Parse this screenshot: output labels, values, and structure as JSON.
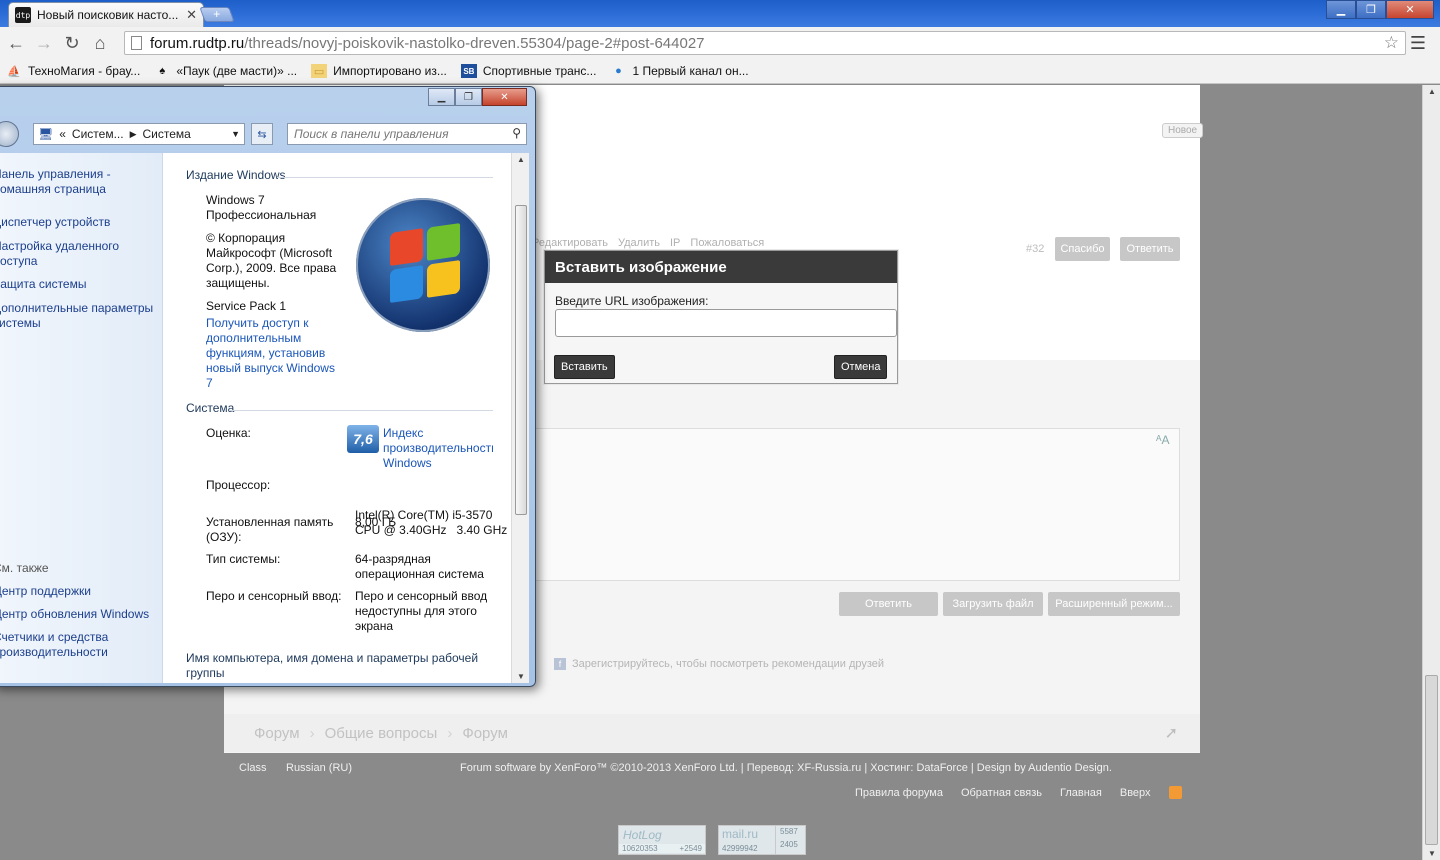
{
  "browser": {
    "tab_title": "Новый поисковик насто...",
    "tab_favicon_text": "dtp",
    "new_tab_symbol": "+",
    "window_buttons": [
      "▁",
      "❐",
      "✕"
    ],
    "nav": {
      "back_icon": "arrow-left-icon",
      "forward_icon": "arrow-right-icon",
      "reload_icon": "reload-icon",
      "home_icon": "home-icon"
    },
    "url_host": "forum.rudtp.ru",
    "url_path": "/threads/novyj-poiskovik-nastolko-dreven.55304/page-2#post-644027",
    "bookmarks": [
      {
        "label": "ТехноМагия - брау...",
        "icon": "⛵"
      },
      {
        "label": "«Паук (две масти)» ...",
        "icon": "♠"
      },
      {
        "label": "Импортировано из...",
        "icon": "▭"
      },
      {
        "label": "Спортивные транс...",
        "icon": "SB"
      },
      {
        "label": "1 Первый канал он...",
        "icon": "●"
      }
    ]
  },
  "forum": {
    "new_badge": "Новое",
    "post_actions": [
      "Редактировать",
      "Удалить",
      "IP",
      "Пожаловаться"
    ],
    "post_number": "#32",
    "thanks_button": "Спасибо",
    "reply_button_top": "Ответить",
    "reply_button": "Ответить",
    "upload_button": "Загрузить файл",
    "advanced_button": "Расширенный режим...",
    "facebook_text": "Зарегистрируйтесь, чтобы посмотреть рекомендации друзей",
    "breadcrumb": [
      "Форум",
      "Общие вопросы",
      "Форум"
    ],
    "footer": {
      "style": "Class",
      "language": "Russian (RU)",
      "credits": "Forum software by XenForo™ ©2010-2013 XenForo Ltd. | Перевод: XF-Russia.ru | Хостинг: DataForce | Design by Audentio Design.",
      "links": [
        "Правила форума",
        "Обратная связь",
        "Главная",
        "Вверх"
      ]
    },
    "counters": {
      "hotlog": {
        "name": "HotLog",
        "n1": "10620353",
        "n2": "+2549"
      },
      "mailru": {
        "name": "mail.ru",
        "n1": "42999942",
        "n2": "5587",
        "n3": "2405"
      }
    }
  },
  "modal": {
    "title": "Вставить изображение",
    "label": "Введите URL изображения:",
    "input_value": "",
    "insert_button": "Вставить",
    "cancel_button": "Отмена"
  },
  "win7": {
    "breadcrumb": [
      "Систем...",
      "Система"
    ],
    "search_placeholder": "Поиск в панели управления",
    "left_links": [
      "Панель управления -",
      "домашняя страница",
      "Диспетчер устройств",
      "Настройка удаленного",
      "доступа",
      "Защита системы",
      "Дополнительные параметры",
      "системы"
    ],
    "see_also": "См. также",
    "see_also_links": [
      "Центр поддержки",
      "Центр обновления Windows",
      "Счетчики и средства",
      "производительности"
    ],
    "edition_section": "Издание Windows",
    "edition_lines": [
      "Windows 7",
      "Профессиональная"
    ],
    "copyright_lines": [
      "© Корпорация",
      "Майкрософт (Microsoft",
      "Corp.), 2009. Все права",
      "защищены."
    ],
    "service_pack": "Service Pack 1",
    "upgrade_link_lines": [
      "Получить доступ к",
      "дополнительным",
      "функциям, установив",
      "новый выпуск Windows",
      "7"
    ],
    "system_section": "Система",
    "rating_label": "Оценка:",
    "rating_value": "7,6",
    "rating_link_lines": [
      "Индекс",
      "производительности",
      "Windows"
    ],
    "cpu_label": "Процессор:",
    "cpu_value_lines": [
      "Intel(R) Core(TM) i5-3570",
      "CPU @ 3.40GHz   3.40 GHz"
    ],
    "ram_label_lines": [
      "Установленная память",
      "(ОЗУ):"
    ],
    "ram_value": "8,00 ГБ",
    "type_label": "Тип системы:",
    "type_value_lines": [
      "64-разрядная",
      "операционная система"
    ],
    "pen_label": "Перо и сенсорный ввод:",
    "pen_value_lines": [
      "Перо и сенсорный ввод",
      "недоступны для этого",
      "экрана"
    ],
    "computer_section_lines": [
      "Имя компьютера, имя домена и параметры рабочей",
      "группы"
    ]
  }
}
